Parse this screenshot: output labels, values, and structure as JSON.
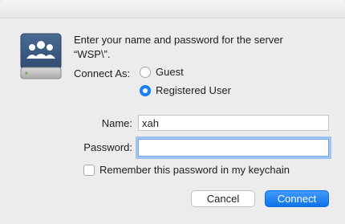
{
  "dialog": {
    "prompt": "Enter your name and password for the server “WSP\\”.",
    "icon": "shared-server-drive-icon"
  },
  "connect_as": {
    "label": "Connect As:",
    "options": [
      {
        "label": "Guest",
        "selected": false
      },
      {
        "label": "Registered User",
        "selected": true
      }
    ]
  },
  "fields": {
    "name_label": "Name:",
    "name_value": "xah",
    "password_label": "Password:",
    "password_value": ""
  },
  "remember": {
    "label": "Remember this password in my keychain",
    "checked": false
  },
  "buttons": {
    "cancel": "Cancel",
    "connect": "Connect"
  },
  "colors": {
    "accent": "#1a82fb",
    "background": "#ececec",
    "icon_blue": "#3b5a82"
  }
}
